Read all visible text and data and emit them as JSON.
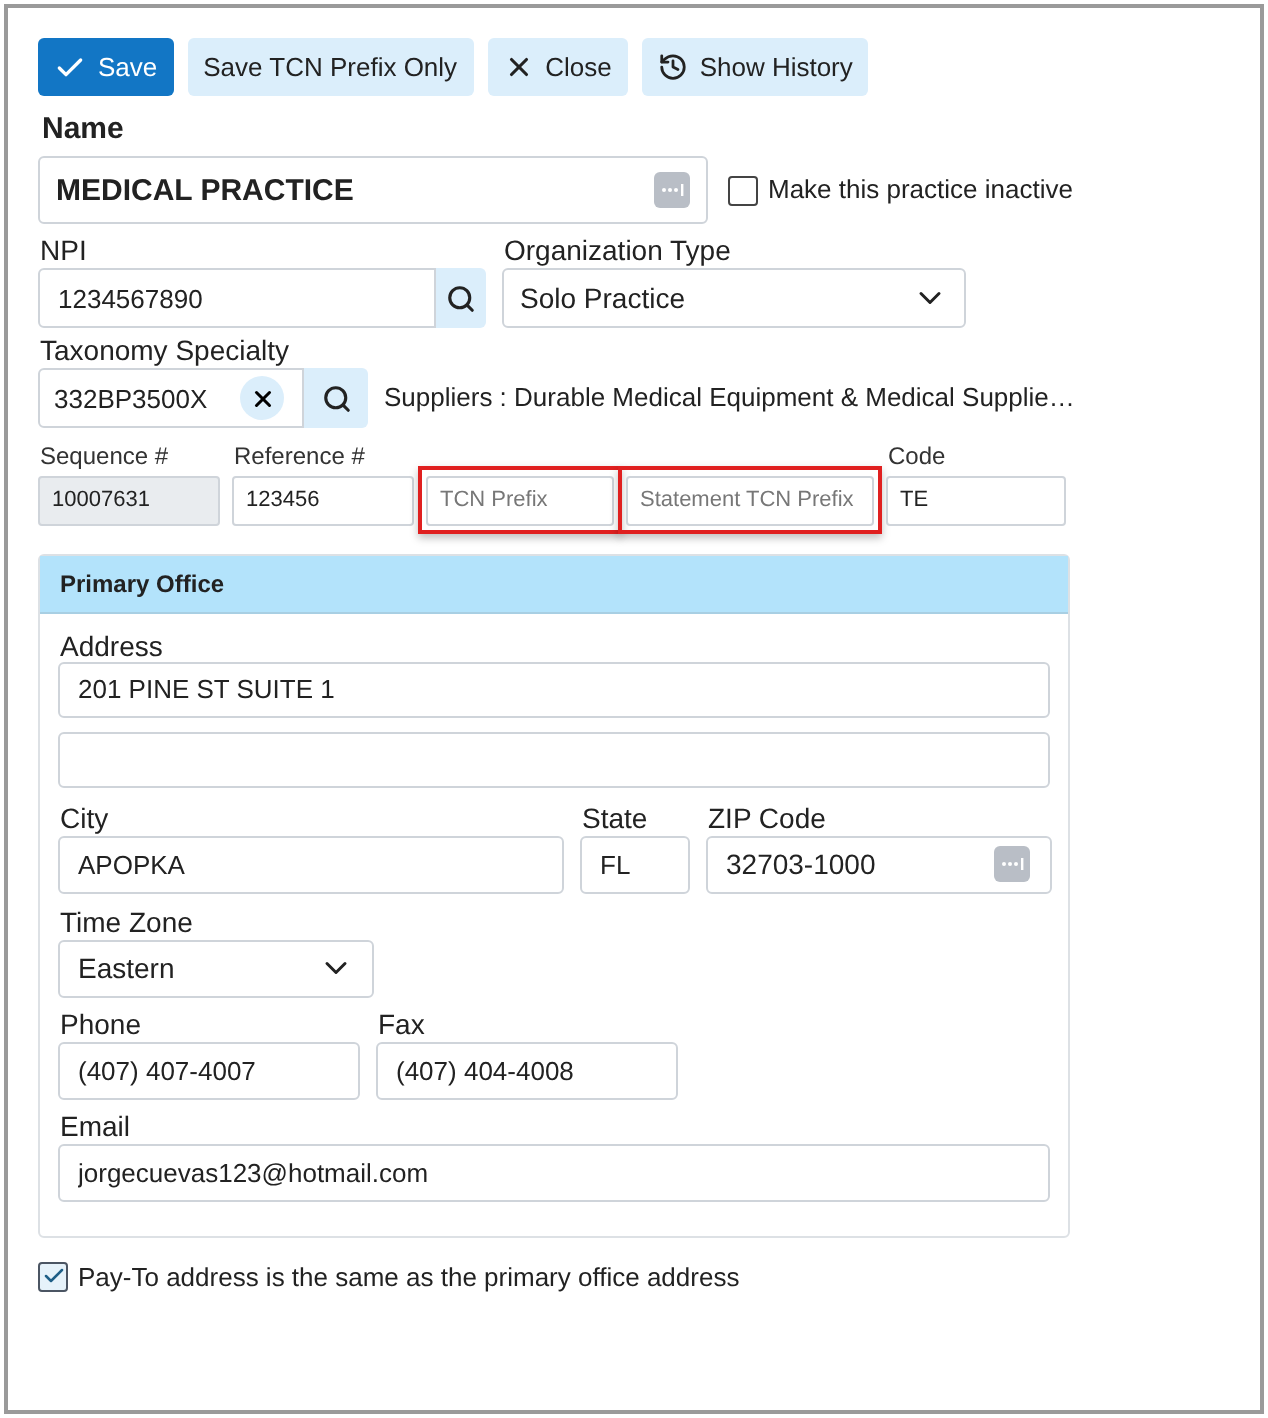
{
  "toolbar": [
    {
      "label": "Save",
      "kind": "save"
    },
    {
      "label": "Save TCN Prefix Only",
      "kind": "plain"
    },
    {
      "label": "Close",
      "kind": "close"
    },
    {
      "label": "Show History",
      "kind": "history"
    }
  ],
  "name": {
    "label": "Name",
    "value": "MEDICAL PRACTICE"
  },
  "inactive": {
    "label": "Make this practice inactive",
    "checked": false
  },
  "npi": {
    "label": "NPI",
    "value": "1234567890"
  },
  "organization_type": {
    "label": "Organization Type",
    "value": "Solo Practice"
  },
  "taxonomy": {
    "label": "Taxonomy Specialty",
    "value": "332BP3500X",
    "description": "Suppliers : Durable Medical Equipment & Medical Supplie…"
  },
  "codes": [
    {
      "label": "Sequence #",
      "value": "10007631",
      "disabled": true,
      "highlighted": false
    },
    {
      "label": "Reference #",
      "value": "123456",
      "disabled": false,
      "highlighted": false
    },
    {
      "placeholder": "TCN Prefix",
      "disabled": false,
      "highlighted": true
    },
    {
      "placeholder": "Statement TCN Prefix",
      "disabled": false,
      "highlighted": true
    },
    {
      "label": "Code",
      "value": "TE",
      "disabled": false,
      "highlighted": false
    }
  ],
  "primary_office": {
    "title": "Primary Office",
    "address": {
      "label": "Address",
      "value": "201 PINE ST SUITE 1"
    },
    "city": {
      "label": "City",
      "value": "APOPKA"
    },
    "state": {
      "label": "State",
      "value": "FL"
    },
    "zip": {
      "label": "ZIP Code",
      "value": "32703-1000"
    },
    "time_zone": {
      "label": "Time Zone",
      "value": "Eastern"
    },
    "phone": {
      "label": "Phone",
      "value": "(407) 407-4007"
    },
    "fax": {
      "label": "Fax",
      "value": "(407) 404-4008"
    },
    "email": {
      "label": "Email",
      "value": "jorgecuevas123@hotmail.com"
    }
  },
  "pay_to": {
    "label": "Pay-To address is the same as the primary office address",
    "checked": true
  }
}
